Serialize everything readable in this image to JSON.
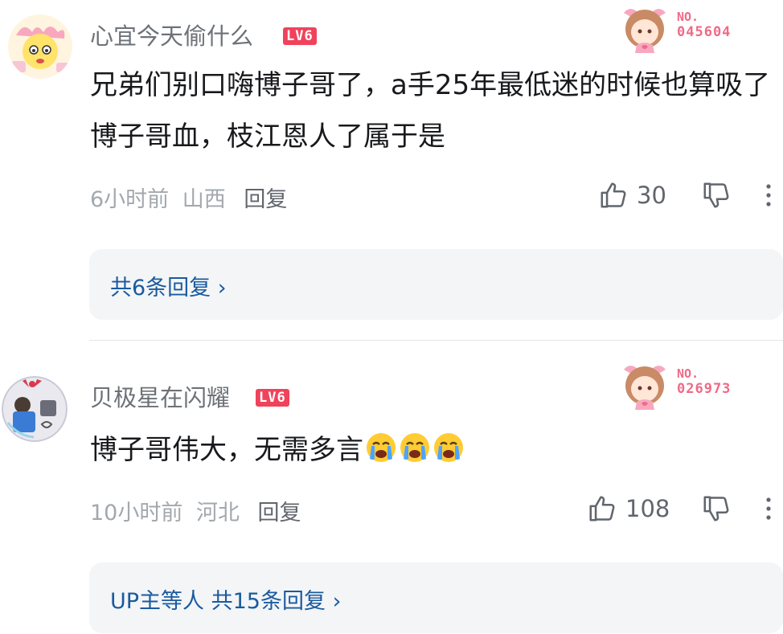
{
  "comments": [
    {
      "username": "心宜今天偷什么",
      "level": "LV6",
      "fan_no_label": "NO.",
      "fan_no": "045604",
      "text": "兄弟们别口嗨博子哥了，a手25年最低迷的时候也算吸了博子哥血，枝江恩人了属于是",
      "time": "6小时前",
      "location": "山西",
      "reply_label": "回复",
      "likes": "30",
      "replies_link": "共6条回复 ›"
    },
    {
      "username": "贝极星在闪耀",
      "level": "LV6",
      "fan_no_label": "NO.",
      "fan_no": "026973",
      "text": "博子哥伟大，无需多言",
      "emojis": [
        "crying-emoji",
        "crying-emoji",
        "crying-emoji"
      ],
      "time": "10小时前",
      "location": "河北",
      "reply_label": "回复",
      "likes": "108",
      "replies_link": "UP主等人 共15条回复 ›"
    }
  ],
  "colors": {
    "level_badge": "#f0435b",
    "fan_badge_text": "#f06a86",
    "reply_link": "#1b5a9e",
    "reply_box_bg": "#f3f5f7",
    "muted_text": "#a3a8ad",
    "body_text": "#18191c"
  },
  "icons": {
    "like": "thumbs-up-icon",
    "dislike": "thumbs-down-icon",
    "more": "more-vertical-icon"
  }
}
